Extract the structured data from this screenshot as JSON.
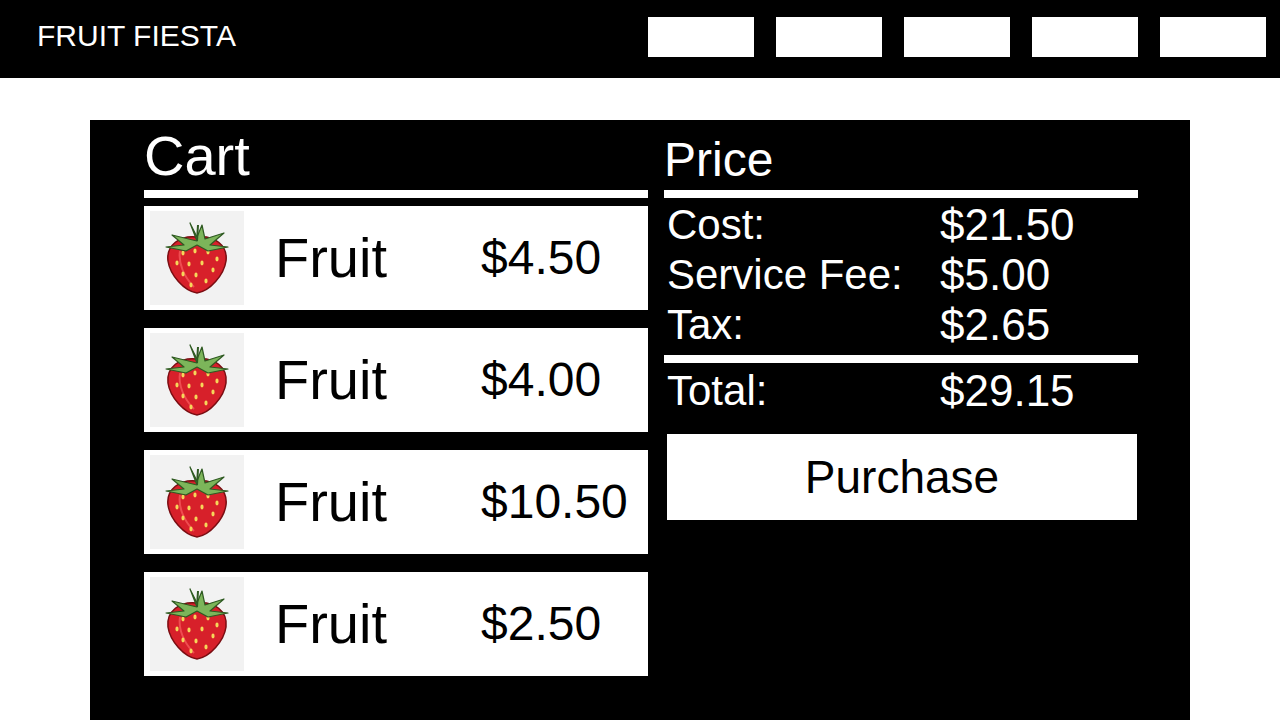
{
  "header": {
    "title": "FRUIT FIESTA"
  },
  "cart": {
    "title": "Cart",
    "items": [
      {
        "name": "Fruit",
        "price": "$4.50"
      },
      {
        "name": "Fruit",
        "price": "$4.00"
      },
      {
        "name": "Fruit",
        "price": "$10.50"
      },
      {
        "name": "Fruit",
        "price": "$2.50"
      }
    ]
  },
  "price": {
    "title": "Price",
    "rows": [
      {
        "label": "Cost:",
        "value": "$21.50"
      },
      {
        "label": "Service Fee:",
        "value": "$5.00"
      },
      {
        "label": "Tax:",
        "value": "$2.65"
      }
    ],
    "total": {
      "label": "Total:",
      "value": "$29.15"
    },
    "button": "Purchase"
  }
}
